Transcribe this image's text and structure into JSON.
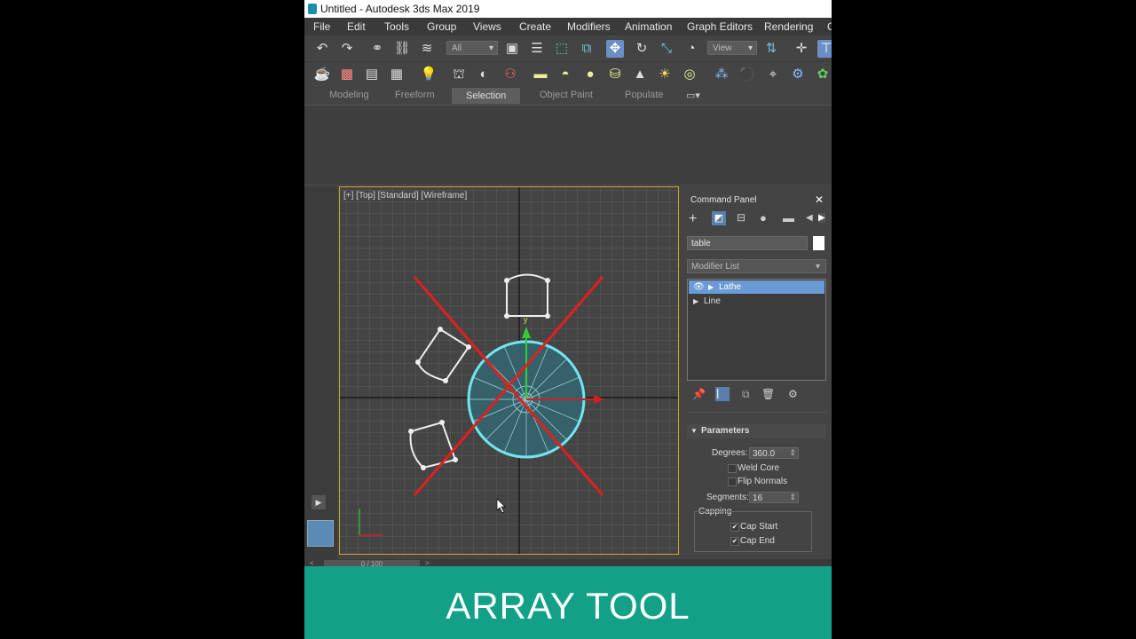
{
  "window": {
    "title": "Untitled - Autodesk 3ds Max 2019"
  },
  "menu": [
    "File",
    "Edit",
    "Tools",
    "Group",
    "Views",
    "Create",
    "Modifiers",
    "Animation",
    "Graph Editors",
    "Rendering",
    "C"
  ],
  "toolbar": {
    "selection_filter": "All",
    "ref_coord": "View"
  },
  "ribbon": {
    "tabs": [
      "Modeling",
      "Freeform",
      "Selection",
      "Object Paint",
      "Populate"
    ],
    "active_tab": "Selection"
  },
  "viewport": {
    "label": "[+] [Top] [Standard] [Wireframe]"
  },
  "command_panel": {
    "title": "Command Panel",
    "object_name": "table",
    "modifier_list_placeholder": "Modifier List",
    "stack": [
      "Lathe",
      "Line"
    ],
    "parameters_title": "Parameters",
    "degrees_label": "Degrees:",
    "degrees_value": "360.0",
    "weld_core": "Weld Core",
    "flip_normals": "Flip Normals",
    "segments_label": "Segments:",
    "segments_value": "16",
    "capping": "Capping",
    "cap_start": "Cap Start",
    "cap_end": "Cap End"
  },
  "timeline": {
    "slider": "0 / 100"
  },
  "banner": {
    "text": "ARRAY TOOL"
  },
  "colors": {
    "accent_green": "#12a187",
    "viewport_border": "#c8a82c",
    "selection_cyan": "#6fe6f0",
    "cross_red": "#e0201e"
  }
}
